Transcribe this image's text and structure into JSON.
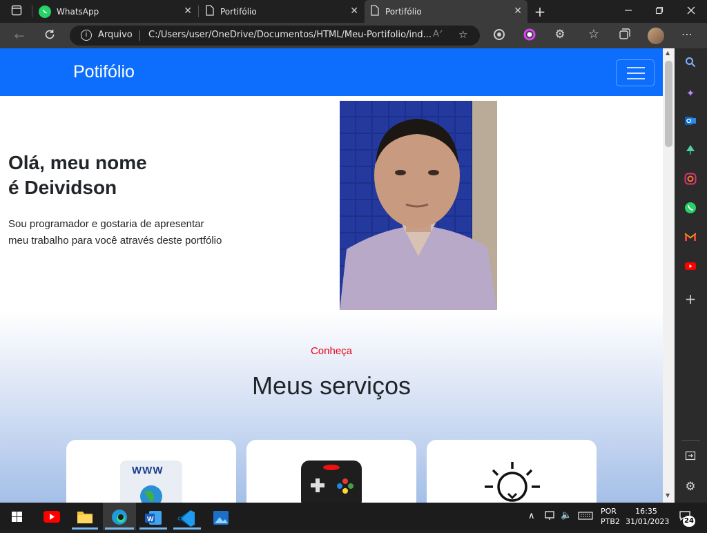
{
  "browser": {
    "tabs": [
      {
        "label": "WhatsApp",
        "icon": "whatsapp-icon"
      },
      {
        "label": "Portifólio",
        "icon": "page-icon"
      },
      {
        "label": "Portifólio",
        "icon": "page-icon"
      }
    ],
    "address": {
      "protocol_label": "Arquivo",
      "url": "C:/Users/user/OneDrive/Documentos/HTML/Meu-Portifolio/ind..."
    }
  },
  "page": {
    "brand": "Potifólio",
    "hero": {
      "title_line1": "Olá, meu nome",
      "title_line2": "é Deividson",
      "text_line1": "Sou programador e gostaria de apresentar",
      "text_line2": "meu trabalho para você através deste portfólio"
    },
    "services": {
      "kicker": "Conheça",
      "title": "Meus serviços",
      "card1_text": "WWW"
    }
  },
  "taskbar": {
    "lang_line1": "POR",
    "lang_line2": "PTB2",
    "time": "16:35",
    "date": "31/01/2023",
    "notifications": "24"
  },
  "colors": {
    "accent": "#0d6efd",
    "kicker": "#e8001c"
  }
}
